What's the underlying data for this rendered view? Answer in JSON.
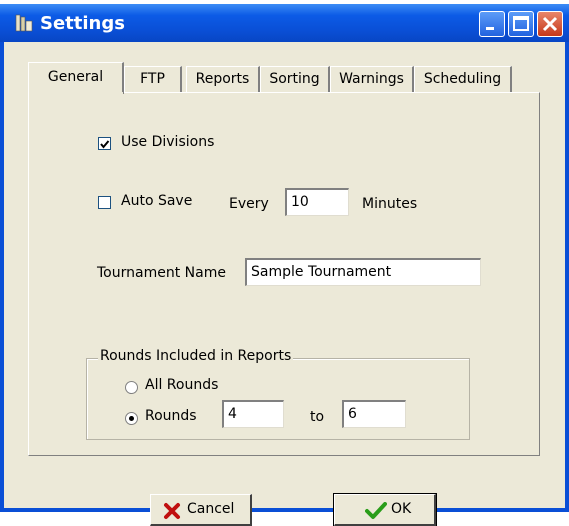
{
  "window": {
    "title": "Settings"
  },
  "tabs": [
    {
      "label": "General"
    },
    {
      "label": "FTP"
    },
    {
      "label": "Reports"
    },
    {
      "label": "Sorting"
    },
    {
      "label": "Warnings"
    },
    {
      "label": "Scheduling"
    }
  ],
  "general": {
    "use_divisions": {
      "label": "Use Divisions",
      "checked": true
    },
    "auto_save": {
      "label": "Auto Save",
      "checked": false,
      "every_label": "Every",
      "interval": "10",
      "unit_label": "Minutes"
    },
    "tournament_name": {
      "label": "Tournament Name",
      "value": "Sample Tournament"
    },
    "rounds_group": {
      "title": "Rounds Included in Reports",
      "all_rounds_label": "All Rounds",
      "rounds_label": "Rounds",
      "from": "4",
      "to_label": "to",
      "to": "6",
      "selected": "rounds"
    }
  },
  "buttons": {
    "cancel": "Cancel",
    "ok": "OK"
  },
  "colors": {
    "titlebar": "#0a4fd6",
    "dialog_bg": "#ece9d8",
    "cancel_icon": "#c01010",
    "ok_icon": "#2a9d1a"
  }
}
